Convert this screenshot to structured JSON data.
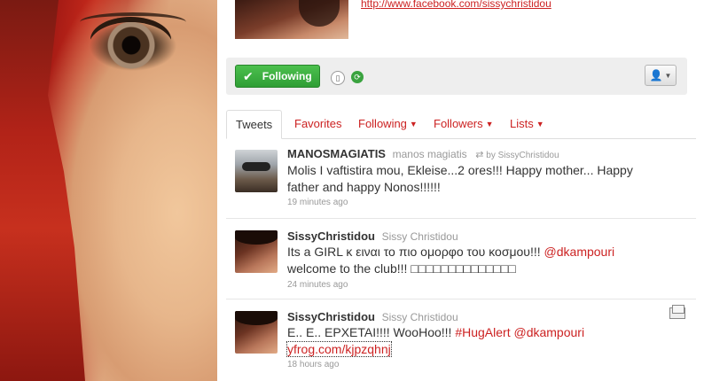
{
  "profile": {
    "facebook_url": "http://www.facebook.com/sissychristidou"
  },
  "actions": {
    "following_label": "Following",
    "device_icon": "device-icon",
    "retweet_icon": "retweet-toggle-icon",
    "user_menu_icon": "user-dropdown-icon"
  },
  "tabs": [
    {
      "label": "Tweets",
      "active": true
    },
    {
      "label": "Favorites"
    },
    {
      "label": "Following",
      "caret": "▼"
    },
    {
      "label": "Followers",
      "caret": "▼"
    },
    {
      "label": "Lists",
      "caret": "▼"
    }
  ],
  "tweets": [
    {
      "screen_name": "MANOSMAGIATIS",
      "full_name": "manos magiatis",
      "retweeted_by": "by SissyChristidou",
      "text_line1": "Molis I vaftistira mou, Ekleise...2 ores!!! Happy mother... Happy",
      "text_line2": "father and happy Nonos!!!!!!",
      "time": "19 minutes ago"
    },
    {
      "screen_name": "SissyChristidou",
      "full_name": "Sissy Christidou",
      "text_line1": "Its a GIRL κ ειναι το πιο ομορφο του κοσμου!!! ",
      "mention": "@dkampouri",
      "text_line2": "welcome to the club!!! □□□□□□□□□□□□□□",
      "time": "24 minutes ago"
    },
    {
      "screen_name": "SissyChristidou",
      "full_name": "Sissy Christidou",
      "text_line1": "Ε.. Ε.. ΕΡΧΕΤΑΙ!!!! WooHoo!!! ",
      "hashtag": "#HugAlert",
      "mention": "@dkampouri",
      "link": "yfrog.com/kjpzqhnj",
      "time": "18 hours ago"
    }
  ],
  "colors": {
    "link": "#cc2222",
    "follow_green": "#2f9e35"
  }
}
